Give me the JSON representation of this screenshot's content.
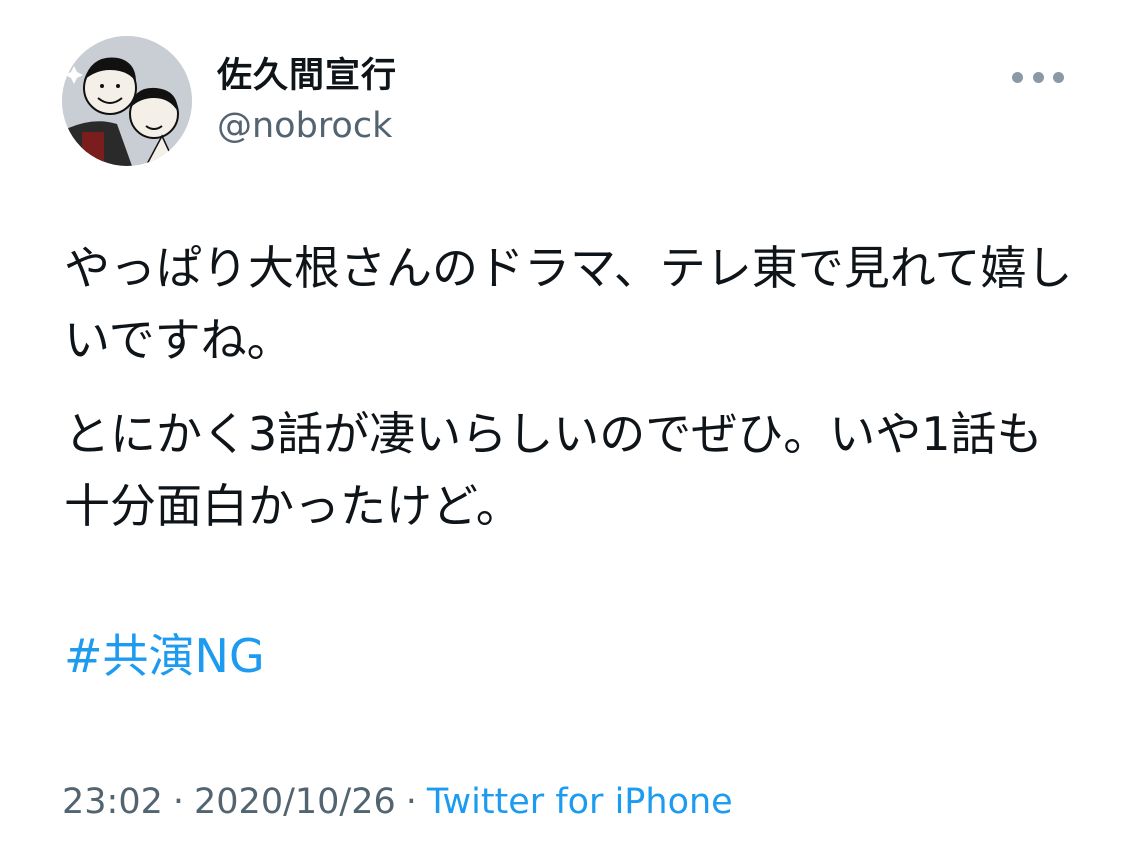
{
  "tweet": {
    "author": {
      "display_name": "佐久間宣行",
      "handle": "@nobrock"
    },
    "more_icon": "more-horizontal-icon",
    "paragraphs": [
      "やっぱり大根さんのドラマ、テレ東で見れて嬉しいですね。",
      "とにかく3話が凄いらしいのでぜひ。いや1話も十分面白かったけど。"
    ],
    "hashtag": "#共演NG",
    "time": "23:02",
    "separator": "·",
    "date": "2020/10/26",
    "source": "Twitter for iPhone"
  },
  "colors": {
    "text": "#0f1419",
    "secondary": "#536471",
    "link": "#1d9bf0"
  }
}
